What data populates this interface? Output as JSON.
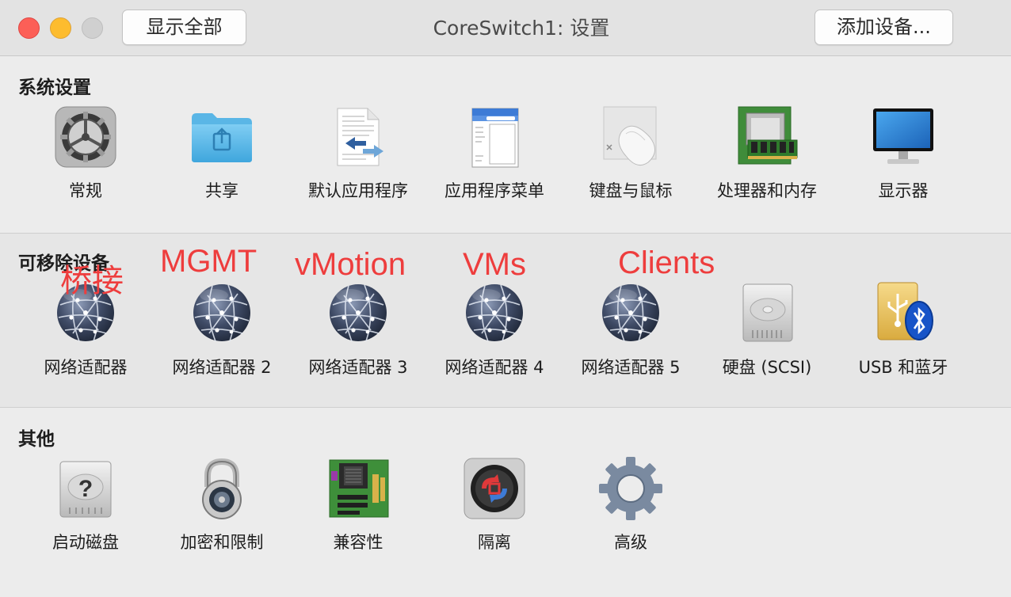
{
  "window": {
    "title": "CoreSwitch1: 设置",
    "show_all_button": "显示全部",
    "add_device_button": "添加设备..."
  },
  "sections": {
    "system": {
      "title": "系统设置",
      "items": [
        {
          "label": "常规",
          "icon": "gear-icon"
        },
        {
          "label": "共享",
          "icon": "shared-folder-icon"
        },
        {
          "label": "默认应用程序",
          "icon": "document-arrows-icon"
        },
        {
          "label": "应用程序菜单",
          "icon": "app-menu-icon"
        },
        {
          "label": "键盘与鼠标",
          "icon": "mouse-icon"
        },
        {
          "label": "处理器和内存",
          "icon": "ram-chip-icon"
        },
        {
          "label": "显示器",
          "icon": "monitor-icon"
        }
      ]
    },
    "removable": {
      "title": "可移除设备",
      "items": [
        {
          "label": "网络适配器",
          "icon": "network-globe-icon"
        },
        {
          "label": "网络适配器 2",
          "icon": "network-globe-icon"
        },
        {
          "label": "网络适配器 3",
          "icon": "network-globe-icon"
        },
        {
          "label": "网络适配器 4",
          "icon": "network-globe-icon"
        },
        {
          "label": "网络适配器 5",
          "icon": "network-globe-icon"
        },
        {
          "label": "硬盘 (SCSI)",
          "icon": "hard-disk-icon"
        },
        {
          "label": "USB 和蓝牙",
          "icon": "usb-bluetooth-icon"
        }
      ]
    },
    "other": {
      "title": "其他",
      "items": [
        {
          "label": "启动磁盘",
          "icon": "startup-disk-icon"
        },
        {
          "label": "加密和限制",
          "icon": "padlock-icon"
        },
        {
          "label": "兼容性",
          "icon": "motherboard-icon"
        },
        {
          "label": "隔离",
          "icon": "isolation-icon"
        },
        {
          "label": "高级",
          "icon": "advanced-gear-icon"
        }
      ]
    }
  },
  "annotations": [
    "桥接",
    "MGMT",
    "vMotion",
    "VMs",
    "Clients"
  ],
  "colors": {
    "annotation": "#ee3d3d",
    "close": "#fc5f57",
    "minimize": "#fdbc2e",
    "maximize_disabled": "#d0d0d0"
  }
}
